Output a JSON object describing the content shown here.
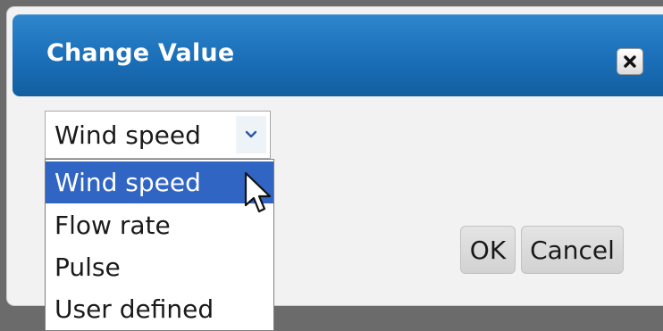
{
  "dialog": {
    "title": "Change Value",
    "close_icon": "close-icon"
  },
  "select": {
    "value": "Wind speed",
    "arrow_icon": "chevron-down-icon",
    "options": [
      {
        "label": "Wind speed",
        "selected": true
      },
      {
        "label": "Flow rate",
        "selected": false
      },
      {
        "label": "Pulse",
        "selected": false
      },
      {
        "label": "User defined",
        "selected": false
      }
    ]
  },
  "buttons": {
    "ok_label": "OK",
    "cancel_label": "Cancel"
  },
  "colors": {
    "titlebar": "#1a6fb8",
    "selected_option": "#3165c4"
  },
  "cursor_icon": "mouse-pointer-icon"
}
